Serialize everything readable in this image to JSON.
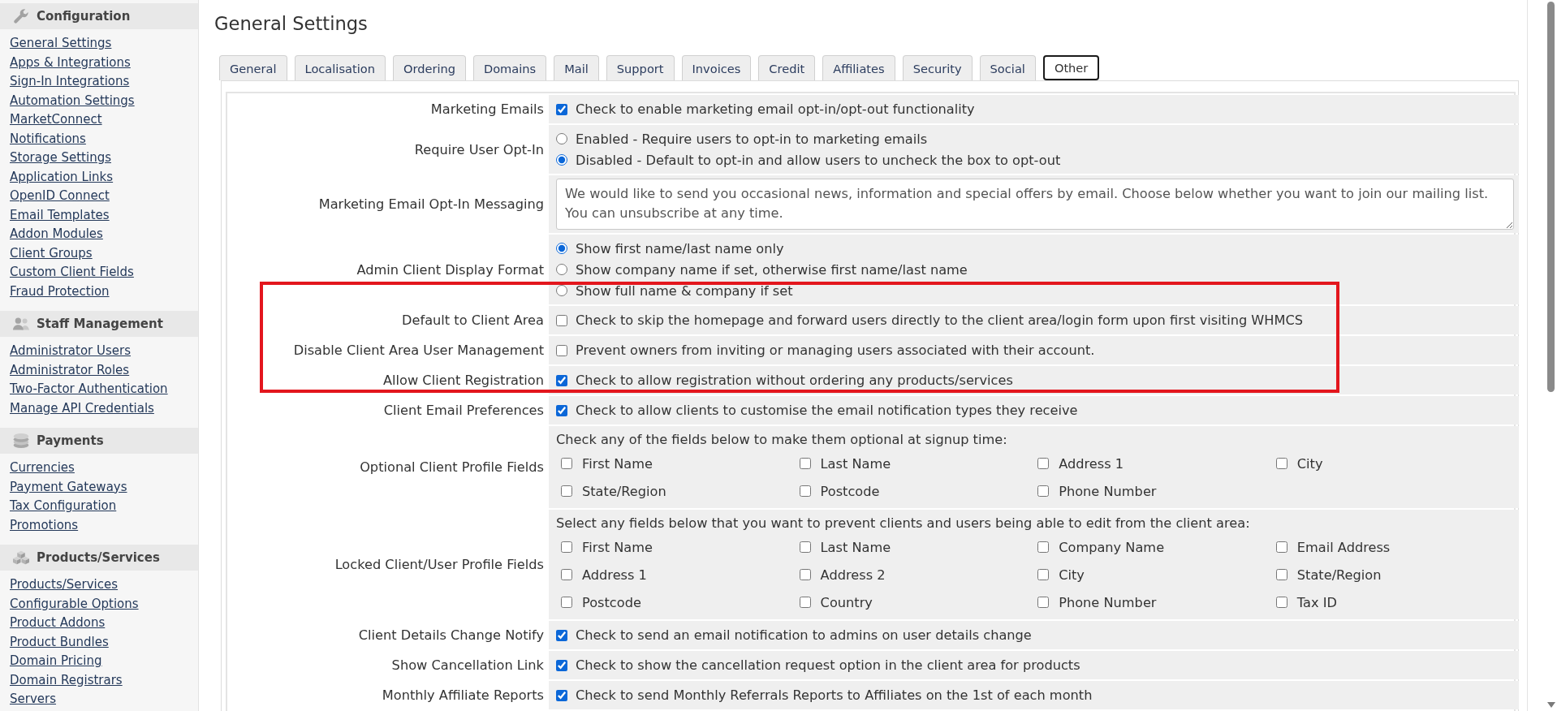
{
  "sidebar": {
    "sections": [
      {
        "title": "Configuration",
        "items": [
          "General Settings",
          "Apps & Integrations",
          "Sign-In Integrations",
          "Automation Settings",
          "MarketConnect",
          "Notifications",
          "Storage Settings",
          "Application Links",
          "OpenID Connect",
          "Email Templates",
          "Addon Modules",
          "Client Groups",
          "Custom Client Fields",
          "Fraud Protection"
        ]
      },
      {
        "title": "Staff Management",
        "items": [
          "Administrator Users",
          "Administrator Roles",
          "Two-Factor Authentication",
          "Manage API Credentials"
        ]
      },
      {
        "title": "Payments",
        "items": [
          "Currencies",
          "Payment Gateways",
          "Tax Configuration",
          "Promotions"
        ]
      },
      {
        "title": "Products/Services",
        "items": [
          "Products/Services",
          "Configurable Options",
          "Product Addons",
          "Product Bundles",
          "Domain Pricing",
          "Domain Registrars",
          "Servers"
        ]
      }
    ]
  },
  "page": {
    "title": "General Settings"
  },
  "tabs": [
    {
      "label": "General",
      "selected": false
    },
    {
      "label": "Localisation",
      "selected": false
    },
    {
      "label": "Ordering",
      "selected": false
    },
    {
      "label": "Domains",
      "selected": false
    },
    {
      "label": "Mail",
      "selected": false
    },
    {
      "label": "Support",
      "selected": false
    },
    {
      "label": "Invoices",
      "selected": false
    },
    {
      "label": "Credit",
      "selected": false
    },
    {
      "label": "Affiliates",
      "selected": false
    },
    {
      "label": "Security",
      "selected": false
    },
    {
      "label": "Social",
      "selected": false
    },
    {
      "label": "Other",
      "selected": true
    }
  ],
  "settings": {
    "rows": [
      {
        "kind": "checkbox",
        "label": "Marketing Emails",
        "checked": true,
        "text": "Check to enable marketing email opt-in/opt-out functionality"
      },
      {
        "kind": "radio",
        "label": "Require User Opt-In",
        "options": [
          {
            "text": "Enabled - Require users to opt-in to marketing emails",
            "selected": false
          },
          {
            "text": "Disabled - Default to opt-in and allow users to uncheck the box to opt-out",
            "selected": true
          }
        ]
      },
      {
        "kind": "textarea",
        "label": "Marketing Email Opt-In Messaging",
        "value": "We would like to send you occasional news, information and special offers by email. Choose below whether you want to join our mailing list. You can unsubscribe at any time."
      },
      {
        "kind": "radio",
        "label": "Admin Client Display Format",
        "options": [
          {
            "text": "Show first name/last name only",
            "selected": true
          },
          {
            "text": "Show company name if set, otherwise first name/last name",
            "selected": false
          },
          {
            "text": "Show full name & company if set",
            "selected": false
          }
        ]
      },
      {
        "kind": "checkbox",
        "label": "Default to Client Area",
        "checked": false,
        "text": "Check to skip the homepage and forward users directly to the client area/login form upon first visiting WHMCS"
      },
      {
        "kind": "checkbox",
        "label": "Disable Client Area User Management",
        "checked": false,
        "text": "Prevent owners from inviting or managing users associated with their account."
      },
      {
        "kind": "checkbox",
        "label": "Allow Client Registration",
        "checked": true,
        "text": "Check to allow registration without ordering any products/services"
      },
      {
        "kind": "checkbox",
        "label": "Client Email Preferences",
        "checked": true,
        "text": "Check to allow clients to customise the email notification types they receive"
      },
      {
        "kind": "checkbox_grid",
        "label": "Optional Client Profile Fields",
        "description": "Check any of the fields below to make them optional at signup time:",
        "fields": [
          {
            "label": "First Name",
            "checked": false
          },
          {
            "label": "Last Name",
            "checked": false
          },
          {
            "label": "Address 1",
            "checked": false
          },
          {
            "label": "City",
            "checked": false
          },
          {
            "label": "State/Region",
            "checked": false
          },
          {
            "label": "Postcode",
            "checked": false
          },
          {
            "label": "Phone Number",
            "checked": false
          }
        ]
      },
      {
        "kind": "checkbox_grid",
        "label": "Locked Client/User Profile Fields",
        "description": "Select any fields below that you want to prevent clients and users being able to edit from the client area:",
        "fields": [
          {
            "label": "First Name",
            "checked": false
          },
          {
            "label": "Last Name",
            "checked": false
          },
          {
            "label": "Company Name",
            "checked": false
          },
          {
            "label": "Email Address",
            "checked": false
          },
          {
            "label": "Address 1",
            "checked": false
          },
          {
            "label": "Address 2",
            "checked": false
          },
          {
            "label": "City",
            "checked": false
          },
          {
            "label": "State/Region",
            "checked": false
          },
          {
            "label": "Postcode",
            "checked": false
          },
          {
            "label": "Country",
            "checked": false
          },
          {
            "label": "Phone Number",
            "checked": false
          },
          {
            "label": "Tax ID",
            "checked": false
          }
        ]
      },
      {
        "kind": "checkbox",
        "label": "Client Details Change Notify",
        "checked": true,
        "text": "Check to send an email notification to admins on user details change"
      },
      {
        "kind": "checkbox",
        "label": "Show Cancellation Link",
        "checked": true,
        "text": "Check to show the cancellation request option in the client area for products"
      },
      {
        "kind": "checkbox",
        "label": "Monthly Affiliate Reports",
        "checked": true,
        "text": "Check to send Monthly Referrals Reports to Affiliates on the 1st of each month"
      }
    ]
  },
  "annotation": {
    "kind": "rectangle"
  }
}
